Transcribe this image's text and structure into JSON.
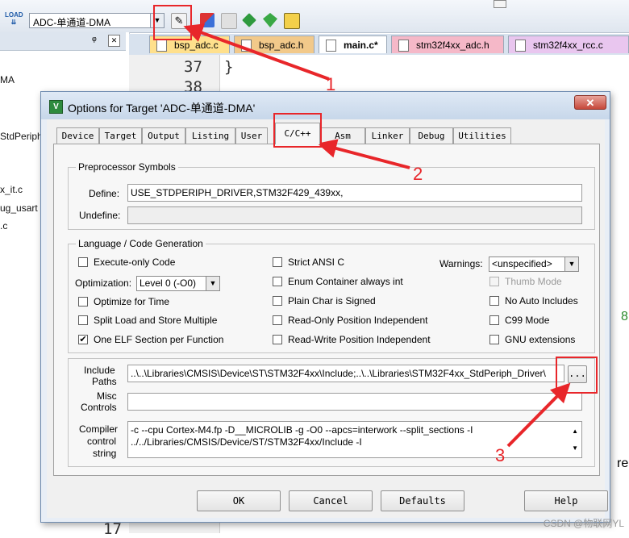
{
  "ide": {
    "toolbar": {
      "target_select_value": "ADC-单通道-DMA",
      "icons": [
        "load-icon",
        "magic-wand-icon",
        "manage-project-items-icon",
        "pack-installer-icon",
        "select-packs-icon",
        "gem-icon",
        "run-icon"
      ]
    },
    "file_tabs": [
      {
        "label": "bsp_adc.c",
        "color": "#ffe08c"
      },
      {
        "label": "bsp_adc.h",
        "color": "#f2c98a"
      },
      {
        "label": "main.c*",
        "color": "#ffe99a"
      },
      {
        "label": "stm32f4xx_adc.h",
        "color": "#f5b8c8"
      },
      {
        "label": "stm32f4xx_rcc.c",
        "color": "#e9c6ef"
      }
    ],
    "left_panel": {
      "pin_glyph": "ᵠ",
      "close_glyph": "✕",
      "fragments": [
        "MA",
        "StdPeriph",
        "x_it.c",
        "ug_usart",
        ".c"
      ]
    },
    "editor": {
      "line_numbers": [
        "37",
        "38",
        "17"
      ],
      "code_line_37": "}",
      "right_edge_chars": [
        "8",
        "re"
      ]
    }
  },
  "dialog": {
    "title": "Options for Target 'ADC-单通道-DMA'",
    "close_glyph": "✕",
    "tabs": [
      {
        "label": "Device",
        "active": false
      },
      {
        "label": "Target",
        "active": false
      },
      {
        "label": "Output",
        "active": false
      },
      {
        "label": "Listing",
        "active": false
      },
      {
        "label": "User",
        "active": false
      },
      {
        "label": "C/C++",
        "active": true
      },
      {
        "label": "Asm",
        "active": false
      },
      {
        "label": "Linker",
        "active": false
      },
      {
        "label": "Debug",
        "active": false
      },
      {
        "label": "Utilities",
        "active": false
      }
    ],
    "preprocessor": {
      "group_title": "Preprocessor Symbols",
      "define_label": "Define:",
      "define_value": "USE_STDPERIPH_DRIVER,STM32F429_439xx,",
      "undefine_label": "Undefine:",
      "undefine_value": ""
    },
    "language": {
      "group_title": "Language / Code Generation",
      "execute_only": {
        "label": "Execute-only Code",
        "checked": false
      },
      "optimization_label": "Optimization:",
      "optimization_value": "Level 0 (-O0)",
      "optimize_time": {
        "label": "Optimize for Time",
        "checked": false
      },
      "split_load": {
        "label": "Split Load and Store Multiple",
        "checked": false
      },
      "one_elf": {
        "label": "One ELF Section per Function",
        "checked": true
      },
      "strict_ansi": {
        "label": "Strict ANSI C",
        "checked": false
      },
      "enum_container": {
        "label": "Enum Container always int",
        "checked": false
      },
      "plain_char": {
        "label": "Plain Char is Signed",
        "checked": false
      },
      "ro_pi": {
        "label": "Read-Only Position Independent",
        "checked": false
      },
      "rw_pi": {
        "label": "Read-Write Position Independent",
        "checked": false
      },
      "warnings_label": "Warnings:",
      "warnings_value": "<unspecified>",
      "thumb_mode": {
        "label": "Thumb Mode",
        "checked": false,
        "disabled": true
      },
      "no_auto_includes": {
        "label": "No Auto Includes",
        "checked": false
      },
      "c99_mode": {
        "label": "C99 Mode",
        "checked": false
      },
      "gnu_ext": {
        "label": "GNU extensions",
        "checked": false
      }
    },
    "paths": {
      "include_label_1": "Include",
      "include_label_2": "Paths",
      "include_value": "..\\..\\Libraries\\CMSIS\\Device\\ST\\STM32F4xx\\Include;..\\..\\Libraries\\STM32F4xx_StdPeriph_Driver\\",
      "browse_label": "...",
      "misc_label_1": "Misc",
      "misc_label_2": "Controls",
      "misc_value": "",
      "compiler_label_1": "Compiler",
      "compiler_label_2": "control",
      "compiler_label_3": "string",
      "compiler_line_1": "-c --cpu Cortex-M4.fp -D__MICROLIB -g -O0 --apcs=interwork --split_sections -I",
      "compiler_line_2": "../../Libraries/CMSIS/Device/ST/STM32F4xx/Include -I"
    },
    "buttons": {
      "ok": "OK",
      "cancel": "Cancel",
      "defaults": "Defaults",
      "help": "Help"
    }
  },
  "annotations": {
    "step_1": "1",
    "step_2": "2",
    "step_3": "3",
    "color": "#e8262a"
  },
  "watermark": "CSDN @物联网YL"
}
